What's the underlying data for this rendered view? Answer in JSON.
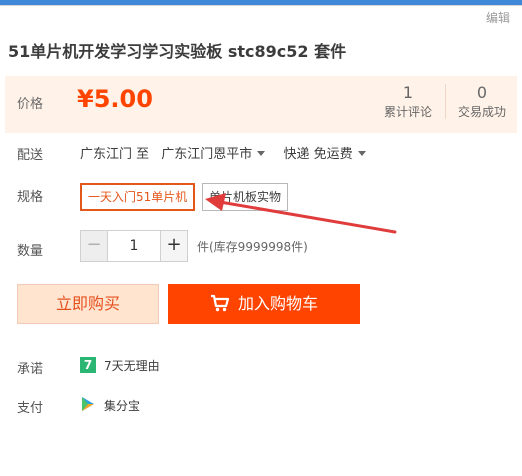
{
  "header": {
    "edit_label": "编辑"
  },
  "product": {
    "title": "51单片机开发学习学习实验板 stc89c52 套件"
  },
  "price_panel": {
    "label": "价格",
    "price": "¥5.00",
    "reviews_count": "1",
    "reviews_label": "累计评论",
    "sold_count": "0",
    "sold_label": "交易成功"
  },
  "shipping": {
    "label": "配送",
    "origin": "广东江门 至",
    "destination": "广东江门恩平市",
    "method": "快递 免运费"
  },
  "spec": {
    "label": "规格",
    "options": [
      "一天入门51单片机",
      "单片机板实物"
    ],
    "selected": "一天入门51单片机"
  },
  "quantity": {
    "label": "数量",
    "minus": "−",
    "value": "1",
    "plus": "+",
    "stock": "件(库存9999998件)"
  },
  "actions": {
    "buy_now": "立即购买",
    "add_to_cart": "加入购物车"
  },
  "promise": {
    "label": "承诺",
    "icon_text": "7",
    "text": "7天无理由"
  },
  "payment": {
    "label": "支付",
    "text": "集分宝"
  },
  "colors": {
    "accent": "#ff4400",
    "price_bg": "#fff2e8",
    "annotation_arrow": "#e03c3c",
    "top_bar": "#3f87d9"
  },
  "icons": [
    "cart-icon",
    "caret-down-icon",
    "seven-day-icon",
    "jifenbao-icon",
    "arrow-annotation"
  ]
}
